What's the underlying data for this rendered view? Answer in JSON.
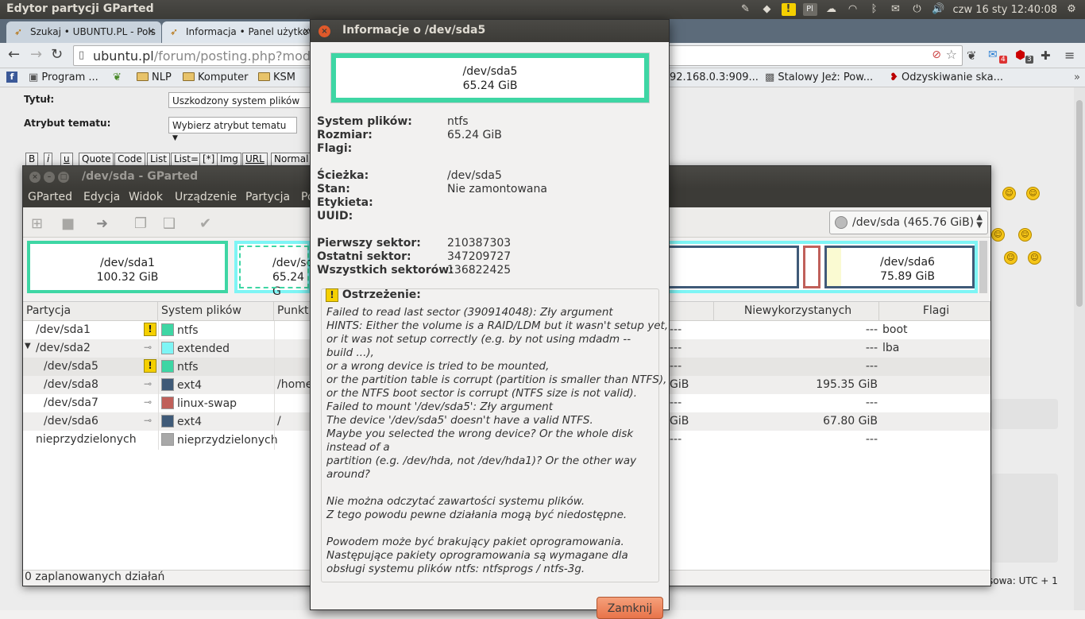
{
  "top_panel": {
    "title": "Edytor partycji GParted",
    "pl_badge": "Pl",
    "clock": "czw 16 sty 12:40:08"
  },
  "browser": {
    "tabs": [
      {
        "label": "Szukaj • UBUNTU.PL - Pols",
        "close": "×"
      },
      {
        "label": "Informacja • Panel użytkow",
        "close": "×"
      }
    ],
    "url_host": "ubuntu.pl",
    "url_path": "/forum/posting.php?mode=p",
    "bookmarks": [
      {
        "label": "Program ..."
      },
      {
        "label": "NLP"
      },
      {
        "label": "Komputer"
      },
      {
        "label": "KSM"
      },
      {
        "label": "92.168.0.3:909..."
      },
      {
        "label": "Stalowy Jeż: Pow..."
      },
      {
        "label": "Odzyskiwanie ska..."
      }
    ],
    "ext_badges": [
      "4",
      "3"
    ]
  },
  "webpage": {
    "title_label": "Tytuł:",
    "title_value": "Uszkodzony system plików",
    "attr_label": "Atrybut tematu:",
    "attr_value": "Wybierz atrybut tematu",
    "bbcode_buttons": [
      "B",
      "i",
      "u",
      "Quote",
      "Code",
      "List",
      "List=",
      "[*]",
      "Img",
      "URL",
      "Normal"
    ],
    "timezone": "sowa: UTC + 1"
  },
  "gparted": {
    "title": "/dev/sda - GParted",
    "menu": [
      "GParted",
      "Edycja",
      "Widok",
      "Urządzenie",
      "Partycja",
      "Po"
    ],
    "device_selector": "/dev/sda  (465.76 GiB)",
    "partition_boxes": [
      {
        "name": "/dev/sda1",
        "size": "100.32 GiB"
      },
      {
        "name": "/dev/sc",
        "size": "65.24 G"
      },
      {
        "name": "/dev/sda6",
        "size": "75.89 GiB"
      }
    ],
    "columns": [
      "Partycja",
      "System plików",
      "Punkt",
      "Niewykorzystanych",
      "Flagi"
    ],
    "rows": [
      {
        "partition": "/dev/sda1",
        "fs": "ntfs",
        "color": "#3ed6a4",
        "mount": "",
        "used_tail": "---",
        "unused": "---",
        "flags": "boot",
        "icon": "warn"
      },
      {
        "partition": "/dev/sda2",
        "fs": "extended",
        "color": "#7ef5f5",
        "mount": "",
        "used_tail": "---",
        "unused": "---",
        "flags": "lba",
        "icon": "key"
      },
      {
        "partition": "/dev/sda5",
        "fs": "ntfs",
        "color": "#3ed6a4",
        "mount": "",
        "used_tail": "---",
        "unused": "---",
        "flags": "",
        "icon": "warn"
      },
      {
        "partition": "/dev/sda8",
        "fs": "ext4",
        "color": "#3f5a78",
        "mount": "/home",
        "used_tail": "GiB",
        "unused": "195.35 GiB",
        "flags": "",
        "icon": "key"
      },
      {
        "partition": "/dev/sda7",
        "fs": "linux-swap",
        "color": "#c0605a",
        "mount": "",
        "used_tail": "---",
        "unused": "---",
        "flags": "",
        "icon": "key"
      },
      {
        "partition": "/dev/sda6",
        "fs": "ext4",
        "color": "#3f5a78",
        "mount": "/",
        "used_tail": "GiB",
        "unused": "67.80 GiB",
        "flags": "",
        "icon": "key"
      },
      {
        "partition": "nieprzydzielonych",
        "fs": "nieprzydzielonych",
        "color": "#a8a8a8",
        "mount": "",
        "used_tail": "---",
        "unused": "---",
        "flags": "",
        "icon": ""
      }
    ],
    "status": "0 zaplanowanych działań"
  },
  "dialog": {
    "title": "Informacje o /dev/sda5",
    "device": "/dev/sda5",
    "size": "65.24 GiB",
    "fields": [
      {
        "label": "System plików:",
        "value": "ntfs"
      },
      {
        "label": "Rozmiar:",
        "value": "65.24 GiB"
      },
      {
        "label": "Flagi:",
        "value": ""
      },
      {
        "label": "Ścieżka:",
        "value": "/dev/sda5"
      },
      {
        "label": "Stan:",
        "value": "Nie zamontowana"
      },
      {
        "label": "Etykieta:",
        "value": ""
      },
      {
        "label": "UUID:",
        "value": ""
      },
      {
        "label": "Pierwszy sektor:",
        "value": "210387303"
      },
      {
        "label": "Ostatni sektor:",
        "value": "347209727"
      },
      {
        "label": "Wszystkich sektorów:",
        "value": "136822425"
      }
    ],
    "warning_title": "Ostrzeżenie:",
    "warning_lines": [
      "Failed to read last sector (390914048): Zły argument",
      "HINTS: Either the volume is a RAID/LDM but it wasn't setup yet,",
      "   or it was not setup correctly (e.g. by not using mdadm --",
      "build ...),",
      "   or a wrong device is tried to be mounted,",
      "   or the partition table is corrupt (partition is smaller than NTFS),",
      "   or the NTFS boot sector is corrupt (NTFS size is not valid).",
      "Failed to mount '/dev/sda5': Zły argument",
      "The device '/dev/sda5' doesn't have a valid NTFS.",
      "Maybe you selected the wrong device? Or the whole disk",
      "instead of a",
      "partition (e.g. /dev/hda, not /dev/hda1)? Or the other way",
      "around?",
      "",
      "Nie można odczytać zawartości systemu plików.",
      "Z tego powodu pewne działania mogą być niedostępne.",
      "",
      "Powodem może być brakujący pakiet oprogramowania.",
      "Następujące pakiety oprogramowania są wymagane dla",
      "obsługi systemu plików ntfs: ntfsprogs / ntfs-3g."
    ],
    "close_button": "Zamknij"
  }
}
